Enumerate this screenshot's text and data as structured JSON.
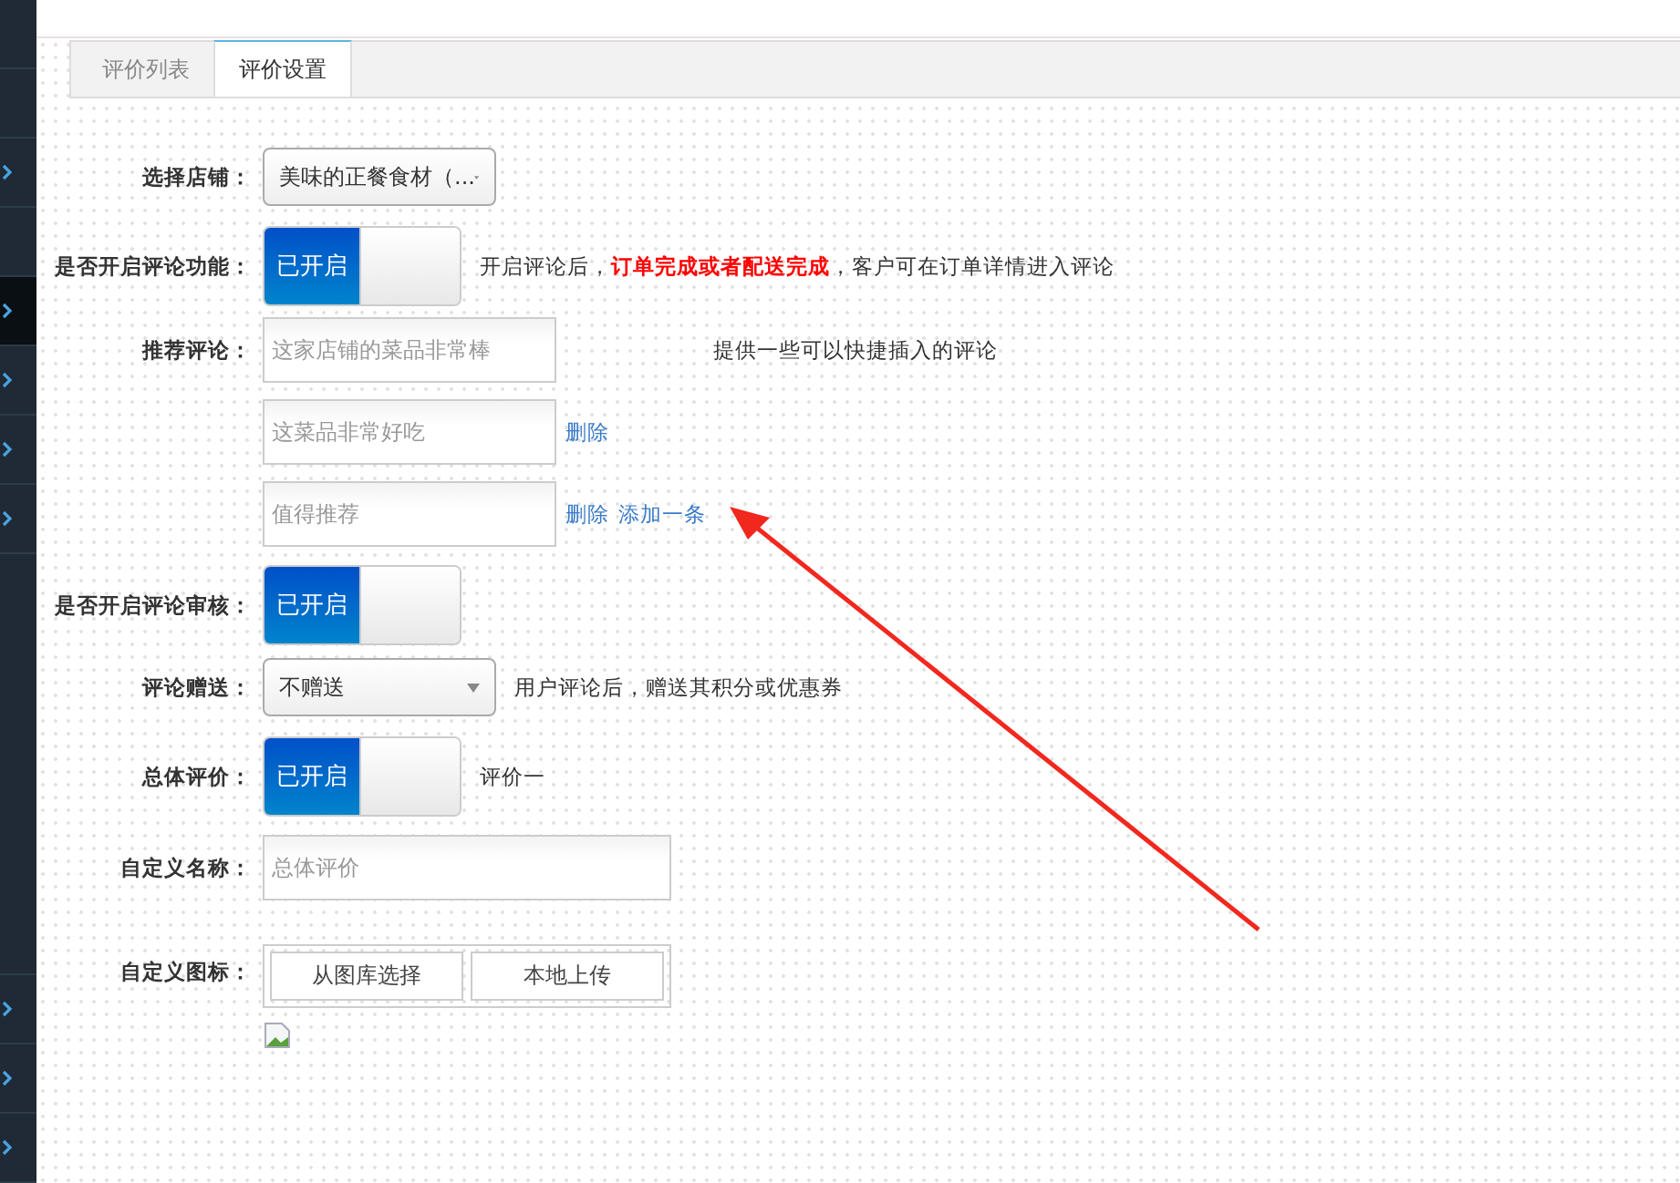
{
  "sidebar": {
    "top_items": [
      {
        "kind": "blank",
        "selected": false
      },
      {
        "kind": "blank",
        "selected": false
      },
      {
        "kind": "arrow",
        "selected": false
      },
      {
        "kind": "blank",
        "selected": false
      },
      {
        "kind": "arrow",
        "selected": true
      },
      {
        "kind": "arrow",
        "selected": false
      },
      {
        "kind": "arrow",
        "selected": false
      },
      {
        "kind": "arrow",
        "selected": false
      }
    ],
    "bottom_items": [
      {
        "kind": "arrow",
        "selected": false
      },
      {
        "kind": "arrow",
        "selected": false
      },
      {
        "kind": "arrow",
        "selected": false
      }
    ]
  },
  "tabs": [
    {
      "label": "评价列表",
      "selected": false
    },
    {
      "label": "评价设置",
      "selected": true
    }
  ],
  "form": {
    "rows": [
      {
        "kind": "select",
        "label": "选择店铺：",
        "value": "美味的正餐食材（..."
      },
      {
        "kind": "switch",
        "label": "是否开启评论功能：",
        "on": true,
        "on_text": "已开启",
        "hint": "开启评论后，**订单完成或者配送完成**，客户可在订单详情进入评论"
      },
      {
        "kind": "comments",
        "label": "推荐评论：",
        "hint": "提供一些可以快捷插入的评论",
        "items": [
          {
            "placeholder": "这家店铺的菜品非常棒"
          },
          {
            "placeholder": "这菜品非常好吃",
            "delete": "删除"
          },
          {
            "placeholder": "值得推荐",
            "delete": "删除",
            "add": "添加一条"
          }
        ]
      },
      {
        "kind": "switch",
        "label": "是否开启评论审核：",
        "on": true,
        "on_text": "已开启"
      },
      {
        "kind": "select",
        "label": "评论赠送：",
        "value": "不赠送",
        "hint": "用户评论后，赠送其积分或优惠券"
      },
      {
        "kind": "switch",
        "label": "总体评价：",
        "on": true,
        "on_text": "已开启",
        "hint": "评价一"
      },
      {
        "kind": "text",
        "label": "自定义名称：",
        "placeholder": "总体评价"
      },
      {
        "kind": "upload",
        "label": "自定义图标：",
        "buttons": [
          "从图库选择",
          "本地上传"
        ]
      }
    ]
  }
}
